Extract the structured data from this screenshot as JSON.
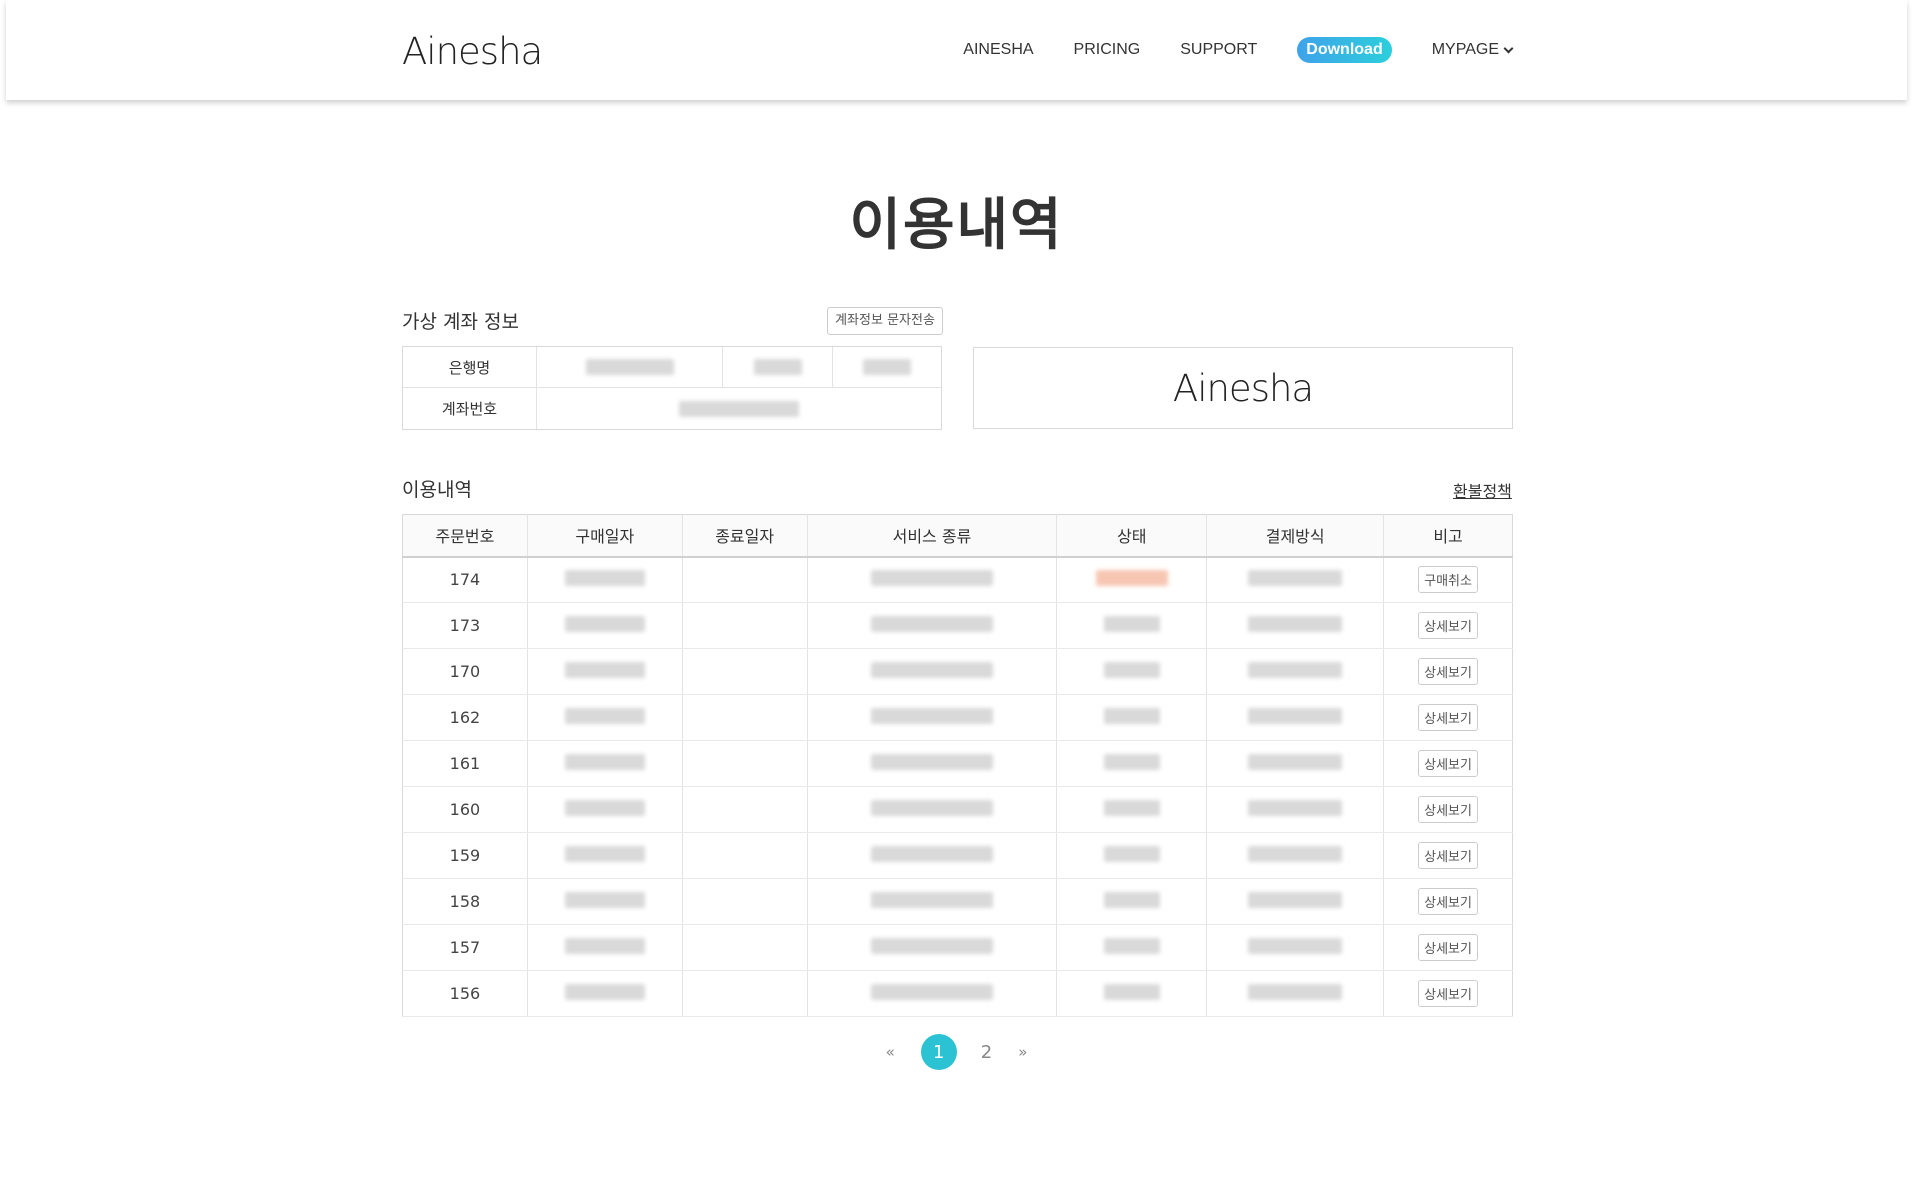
{
  "header": {
    "logo": "Ainesha",
    "nav": [
      "AINESHA",
      "PRICING",
      "SUPPORT"
    ],
    "download": "Download",
    "mypage": "MYPAGE"
  },
  "page_title": "이용내역",
  "account": {
    "section_title": "가상 계좌 정보",
    "sms_button": "계좌정보 문자전송",
    "bank_label": "은행명",
    "account_label": "계좌번호",
    "brand_logo": "Ainesha"
  },
  "usage": {
    "section_title": "이용내역",
    "refund_link": "환불정책",
    "columns": [
      "주문번호",
      "구매일자",
      "종료일자",
      "서비스 종류",
      "상태",
      "결제방식",
      "비고"
    ],
    "rows": [
      {
        "order": "174",
        "action": "구매취소",
        "status_color": "orange"
      },
      {
        "order": "173",
        "action": "상세보기",
        "status_color": "gray"
      },
      {
        "order": "170",
        "action": "상세보기",
        "status_color": "gray"
      },
      {
        "order": "162",
        "action": "상세보기",
        "status_color": "gray"
      },
      {
        "order": "161",
        "action": "상세보기",
        "status_color": "gray"
      },
      {
        "order": "160",
        "action": "상세보기",
        "status_color": "gray"
      },
      {
        "order": "159",
        "action": "상세보기",
        "status_color": "gray"
      },
      {
        "order": "158",
        "action": "상세보기",
        "status_color": "gray"
      },
      {
        "order": "157",
        "action": "상세보기",
        "status_color": "gray"
      },
      {
        "order": "156",
        "action": "상세보기",
        "status_color": "gray"
      }
    ]
  },
  "pagination": {
    "prev": "«",
    "pages": [
      "1",
      "2"
    ],
    "current": "1",
    "next": "»"
  },
  "colors": {
    "accent": "#2bc3d3",
    "download_gradient_start": "#3fa2ea",
    "download_gradient_end": "#2ccfdc"
  }
}
